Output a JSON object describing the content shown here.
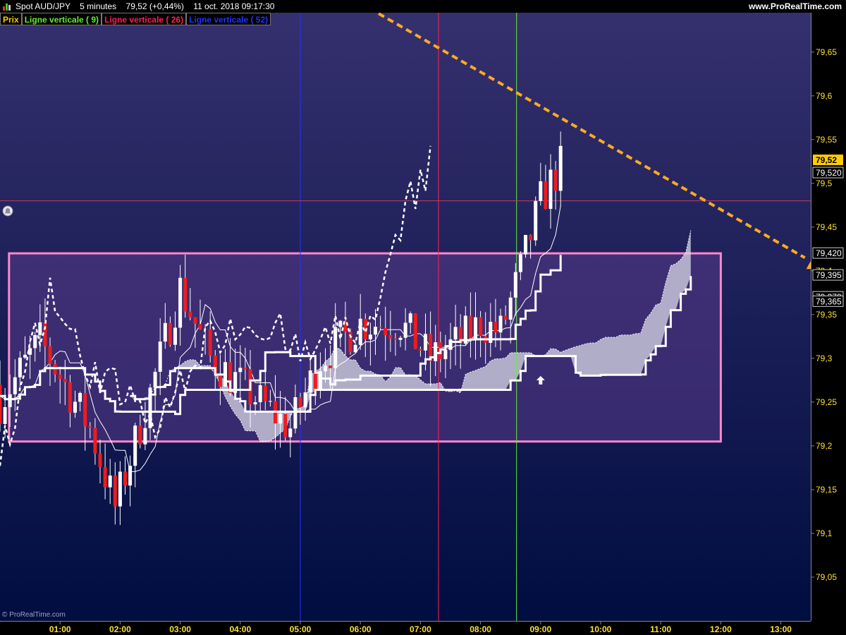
{
  "header": {
    "title": "Spot AUD/JPY    5 minutes    79,52 (+0,44%)    11 oct. 2018 09:17:30",
    "site": "www.ProRealTime.com"
  },
  "legend": {
    "items": [
      {
        "label": "Prix",
        "color": "#ffcc00"
      },
      {
        "label": "Ligne verticale ( 9)",
        "color": "#66ee33"
      },
      {
        "label": "Ligne verticale ( 26)",
        "color": "#ff2255"
      },
      {
        "label": "Ligne verticale ( 52)",
        "color": "#2233ff"
      }
    ]
  },
  "footer": {
    "copyright": "© ProRealTime.com"
  },
  "colors": {
    "bg_top": "#35306e",
    "bg_bottom": "#000d40",
    "bull": "#ffffff",
    "bear": "#ee1c1c",
    "box": "#ff88cc",
    "trend": "#ffaa22",
    "price_tag": "#ffcc00"
  },
  "chart_data": {
    "type": "candlestick",
    "instrument": "Spot AUD/JPY",
    "timeframe": "5 minutes",
    "ylim": [
      79.0,
      79.695
    ],
    "y_ticks": [
      "79,65",
      "79,6",
      "79,55",
      "79,5",
      "79,45",
      "79,4",
      "79,35",
      "79,3",
      "79,25",
      "79,2",
      "79,15",
      "79,1",
      "79,05"
    ],
    "x_ticks": [
      "01:00",
      "02:00",
      "03:00",
      "04:00",
      "05:00",
      "06:00",
      "07:00",
      "08:00",
      "09:00",
      "10:00",
      "11:00",
      "12:00",
      "13:00"
    ],
    "price_labels": [
      "79,52",
      "79,520",
      "79,420",
      "79,395",
      "79,370",
      "79,365"
    ],
    "current_price": 79.52,
    "horizontal_line": 79.48,
    "vertical_lines": [
      {
        "time": "05:00",
        "color": "#2233ff"
      },
      {
        "time": "07:18",
        "color": "#ff2255"
      },
      {
        "time": "08:36",
        "color": "#66ee33"
      }
    ],
    "rectangle": {
      "start": "00:09",
      "end": "12:00",
      "top": 79.42,
      "bottom": 79.205
    },
    "trendline": {
      "start_time": "06:09",
      "start_price": 79.7,
      "end_time": "13:24",
      "end_price": 79.415
    },
    "candles_range": {
      "start": "00:00",
      "end": "09:20",
      "low": 79.11,
      "high": 79.54
    }
  }
}
